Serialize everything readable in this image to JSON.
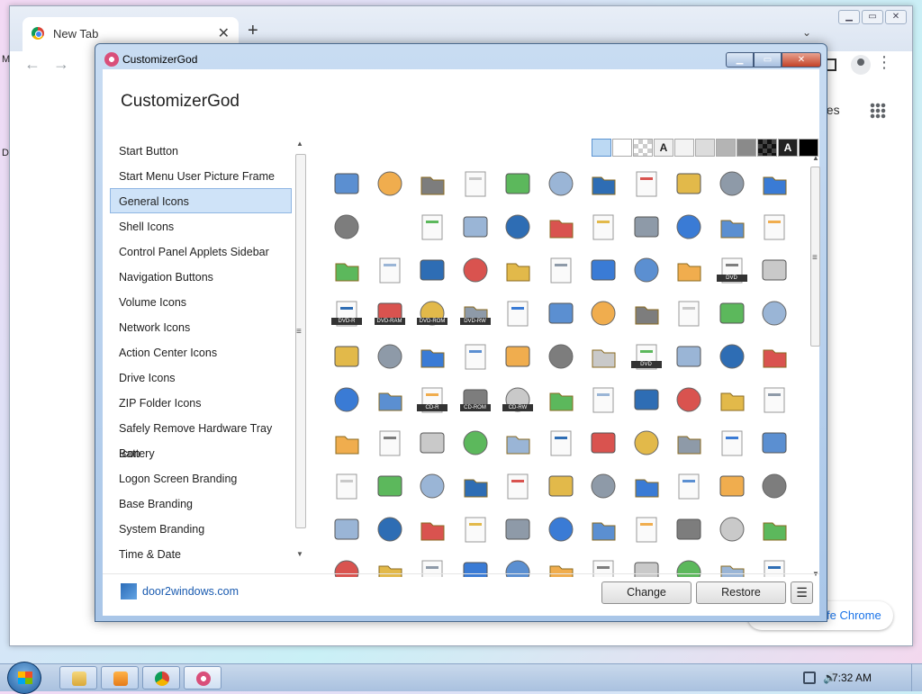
{
  "chrome": {
    "tab_title": "New Tab",
    "tab_close": "✕",
    "new_tab": "+",
    "back": "←",
    "forward": "→",
    "menu": "⋮",
    "images_partial": "ges",
    "customize_partial": "fe Chrome",
    "left_letter_top": "M",
    "left_letter_mid": "D"
  },
  "dialog": {
    "window_title": "CustomizerGod",
    "heading": "CustomizerGod",
    "caption_buttons": [
      "▁",
      "▭",
      "✕"
    ],
    "nav_items": [
      "Start Button",
      "Start Menu User Picture Frame",
      "General Icons",
      "Shell Icons",
      "Control Panel Applets Sidebar",
      "Navigation Buttons",
      "Volume Icons",
      "Network Icons",
      "Action Center Icons",
      "Drive Icons",
      "ZIP Folder Icons",
      "Safely Remove Hardware Tray Icon",
      "Battery",
      "Logon Screen Branding",
      "Base Branding",
      "System Branding",
      "Time & Date"
    ],
    "selected_nav": "General Icons",
    "swatch_letter": "A",
    "icon_labels": [
      "",
      "",
      "",
      "",
      "",
      "",
      "",
      "",
      "",
      "",
      "",
      "",
      "",
      "",
      "",
      "",
      "",
      "",
      "",
      "",
      "",
      "",
      "",
      "",
      "",
      "",
      "",
      "",
      "",
      "",
      "",
      "DVD",
      "",
      "DVD-R",
      "DVD-RAM",
      "DVD-ROM",
      "DVD-RW",
      "",
      "",
      "",
      "",
      "",
      "",
      "",
      "",
      "",
      "",
      "",
      "",
      "",
      "",
      "DVD",
      "",
      "",
      "",
      "",
      "",
      "CD-R",
      "CD-ROM",
      "CD-RW",
      "",
      "",
      "",
      "",
      "",
      "",
      "",
      "",
      "",
      "",
      "",
      "",
      "",
      "",
      "",
      "",
      "",
      "",
      "",
      "",
      "",
      "",
      "",
      "",
      "",
      "",
      "",
      "",
      "",
      "",
      "",
      "",
      "",
      "",
      "",
      "",
      "",
      "",
      ""
    ],
    "link": "door2windows.com",
    "change_button": "Change",
    "restore_button": "Restore",
    "menu_button": "☰"
  },
  "taskbar": {
    "clock": "7:32 AM"
  }
}
